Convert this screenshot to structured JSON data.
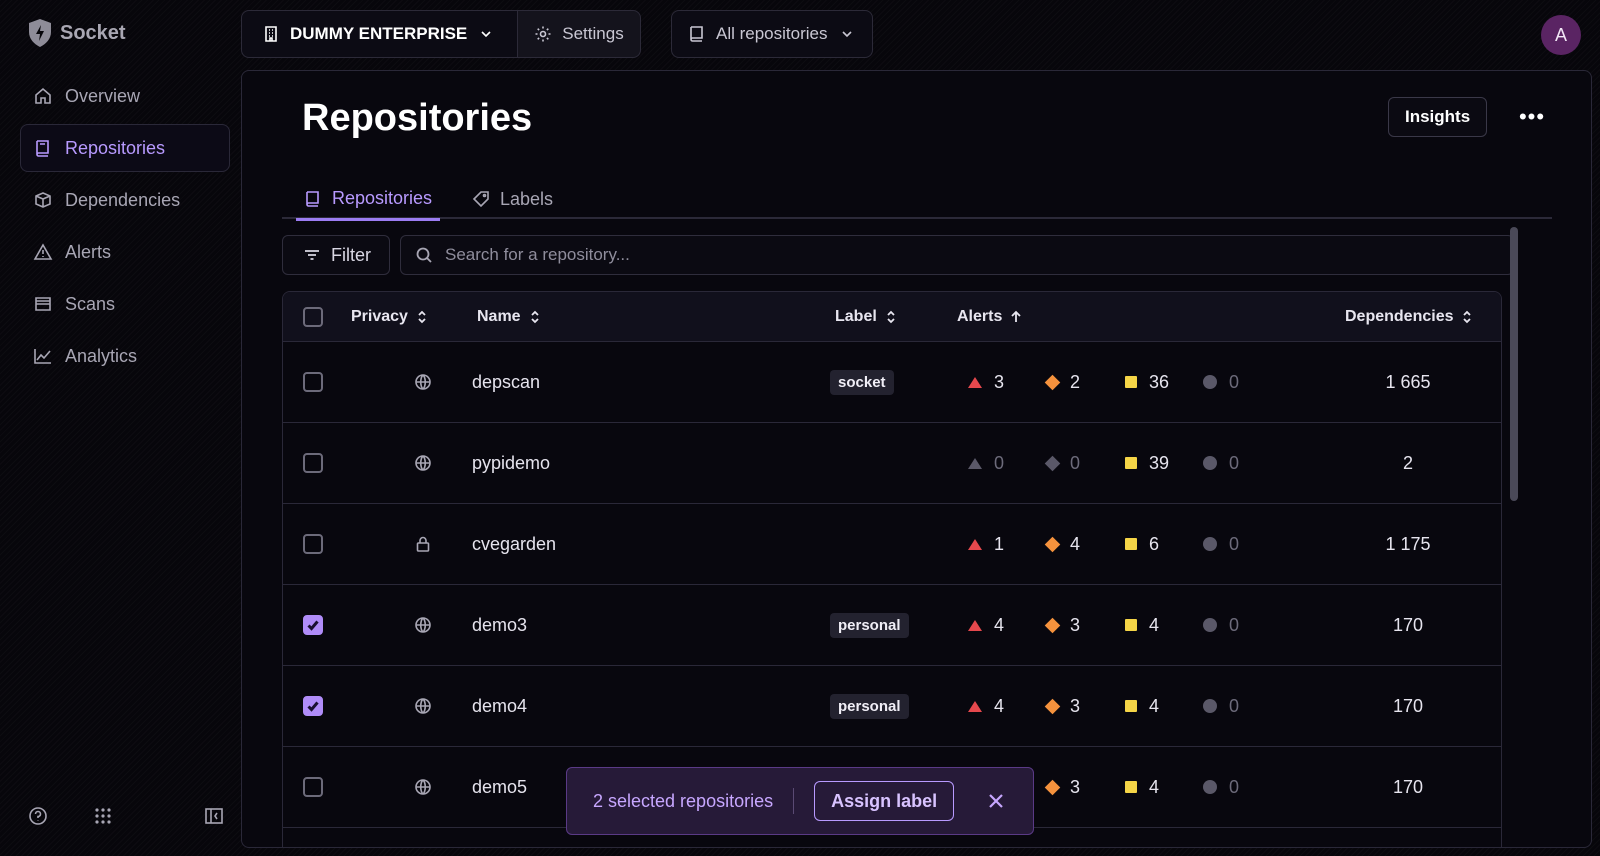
{
  "app": {
    "name": "Socket"
  },
  "sidebar": {
    "items": [
      {
        "label": "Overview",
        "icon": "home-icon",
        "active": false
      },
      {
        "label": "Repositories",
        "icon": "book-icon",
        "active": true
      },
      {
        "label": "Dependencies",
        "icon": "package-icon",
        "active": false
      },
      {
        "label": "Alerts",
        "icon": "warning-icon",
        "active": false
      },
      {
        "label": "Scans",
        "icon": "scan-icon",
        "active": false
      },
      {
        "label": "Analytics",
        "icon": "chart-icon",
        "active": false
      }
    ]
  },
  "topbar": {
    "org": "DUMMY ENTERPRISE",
    "settings": "Settings",
    "repos_selector": "All repositories",
    "avatar_initial": "A"
  },
  "page": {
    "title": "Repositories",
    "insights": "Insights",
    "tabs": [
      {
        "label": "Repositories",
        "active": true
      },
      {
        "label": "Labels",
        "active": false
      }
    ],
    "filter": "Filter",
    "search_placeholder": "Search for a repository..."
  },
  "table": {
    "headers": {
      "privacy": "Privacy",
      "name": "Name",
      "label": "Label",
      "alerts": "Alerts",
      "dependencies": "Dependencies"
    },
    "rows": [
      {
        "checked": false,
        "privacy": "public",
        "name": "depscan",
        "label": "socket",
        "critical": "3",
        "high": "2",
        "medium": "36",
        "low": "0",
        "deps": "1 665"
      },
      {
        "checked": false,
        "privacy": "public",
        "name": "pypidemo",
        "label": "",
        "critical": "0",
        "high": "0",
        "medium": "39",
        "low": "0",
        "deps": "2"
      },
      {
        "checked": false,
        "privacy": "private",
        "name": "cvegarden",
        "label": "",
        "critical": "1",
        "high": "4",
        "medium": "6",
        "low": "0",
        "deps": "1 175"
      },
      {
        "checked": true,
        "privacy": "public",
        "name": "demo3",
        "label": "personal",
        "critical": "4",
        "high": "3",
        "medium": "4",
        "low": "0",
        "deps": "170"
      },
      {
        "checked": true,
        "privacy": "public",
        "name": "demo4",
        "label": "personal",
        "critical": "4",
        "high": "3",
        "medium": "4",
        "low": "0",
        "deps": "170"
      },
      {
        "checked": false,
        "privacy": "public",
        "name": "demo5",
        "label": "",
        "critical": "",
        "high": "3",
        "medium": "4",
        "low": "0",
        "deps": "170"
      }
    ]
  },
  "selection": {
    "text": "2 selected repositories",
    "assign": "Assign label"
  },
  "colors": {
    "accent": "#b89aff",
    "critical": "#e5484d",
    "high": "#f5923d",
    "medium": "#f5d547",
    "low": "#5a5868"
  }
}
